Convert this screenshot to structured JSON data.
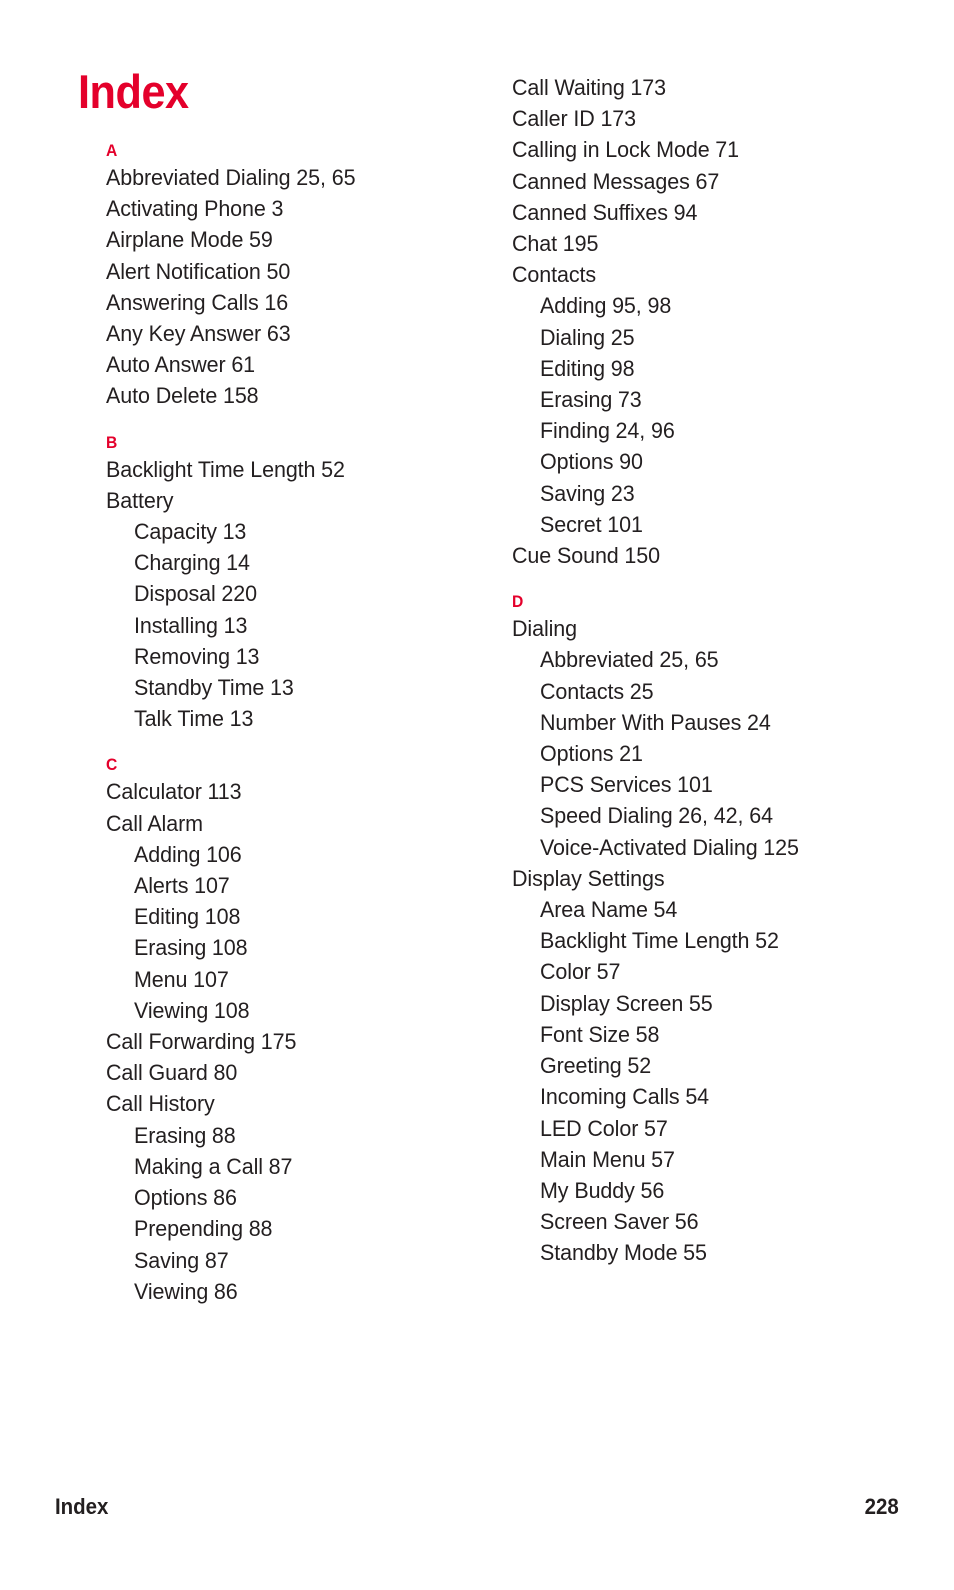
{
  "document": {
    "title": "Index",
    "title_color": "#e4002b",
    "text_color": "#231f20",
    "background_color": "#ffffff"
  },
  "footer": {
    "label": "Index",
    "page_number": "228"
  },
  "columns": [
    {
      "id": "left",
      "sections": [
        {
          "letter": "A",
          "entries": [
            {
              "level": "main",
              "label": "Abbreviated Dialing",
              "pages": "25, 65"
            },
            {
              "level": "main",
              "label": "Activating Phone",
              "pages": "3"
            },
            {
              "level": "main",
              "label": "Airplane Mode",
              "pages": "59"
            },
            {
              "level": "main",
              "label": "Alert Notification",
              "pages": "50"
            },
            {
              "level": "main",
              "label": "Answering Calls",
              "pages": "16"
            },
            {
              "level": "main",
              "label": "Any Key Answer",
              "pages": "63"
            },
            {
              "level": "main",
              "label": "Auto Answer",
              "pages": "61"
            },
            {
              "level": "main",
              "label": "Auto Delete",
              "pages": "158"
            }
          ]
        },
        {
          "letter": "B",
          "entries": [
            {
              "level": "main",
              "label": "Backlight Time Length",
              "pages": "52"
            },
            {
              "level": "main",
              "label": "Battery",
              "pages": ""
            },
            {
              "level": "sub",
              "label": "Capacity",
              "pages": "13"
            },
            {
              "level": "sub",
              "label": "Charging",
              "pages": "14"
            },
            {
              "level": "sub",
              "label": "Disposal",
              "pages": "220"
            },
            {
              "level": "sub",
              "label": "Installing",
              "pages": "13"
            },
            {
              "level": "sub",
              "label": "Removing",
              "pages": "13"
            },
            {
              "level": "sub",
              "label": "Standby Time",
              "pages": "13"
            },
            {
              "level": "sub",
              "label": "Talk Time",
              "pages": "13"
            }
          ]
        },
        {
          "letter": "C",
          "entries": [
            {
              "level": "main",
              "label": "Calculator",
              "pages": "113"
            },
            {
              "level": "main",
              "label": "Call Alarm",
              "pages": ""
            },
            {
              "level": "sub",
              "label": "Adding",
              "pages": "106"
            },
            {
              "level": "sub",
              "label": "Alerts",
              "pages": "107"
            },
            {
              "level": "sub",
              "label": "Editing",
              "pages": "108"
            },
            {
              "level": "sub",
              "label": "Erasing",
              "pages": "108"
            },
            {
              "level": "sub",
              "label": "Menu",
              "pages": "107"
            },
            {
              "level": "sub",
              "label": "Viewing",
              "pages": "108"
            },
            {
              "level": "main",
              "label": "Call Forwarding",
              "pages": "175"
            },
            {
              "level": "main",
              "label": "Call Guard",
              "pages": "80"
            },
            {
              "level": "main",
              "label": "Call History",
              "pages": ""
            },
            {
              "level": "sub",
              "label": "Erasing",
              "pages": "88"
            },
            {
              "level": "sub",
              "label": "Making a Call",
              "pages": "87"
            },
            {
              "level": "sub",
              "label": "Options",
              "pages": "86"
            },
            {
              "level": "sub",
              "label": "Prepending",
              "pages": "88"
            },
            {
              "level": "sub",
              "label": "Saving",
              "pages": "87"
            },
            {
              "level": "sub",
              "label": "Viewing",
              "pages": "86"
            }
          ]
        }
      ]
    },
    {
      "id": "right",
      "sections": [
        {
          "letter": "",
          "continued": true,
          "entries": [
            {
              "level": "main",
              "label": "Call Waiting",
              "pages": "173"
            },
            {
              "level": "main",
              "label": "Caller ID",
              "pages": "173"
            },
            {
              "level": "main",
              "label": "Calling in Lock Mode",
              "pages": "71"
            },
            {
              "level": "main",
              "label": "Canned Messages",
              "pages": "67"
            },
            {
              "level": "main",
              "label": "Canned Suffixes",
              "pages": "94"
            },
            {
              "level": "main",
              "label": "Chat",
              "pages": "195"
            },
            {
              "level": "main",
              "label": "Contacts",
              "pages": ""
            },
            {
              "level": "sub",
              "label": "Adding",
              "pages": "95, 98"
            },
            {
              "level": "sub",
              "label": "Dialing",
              "pages": "25"
            },
            {
              "level": "sub",
              "label": "Editing",
              "pages": "98"
            },
            {
              "level": "sub",
              "label": "Erasing",
              "pages": "73"
            },
            {
              "level": "sub",
              "label": "Finding",
              "pages": "24, 96"
            },
            {
              "level": "sub",
              "label": "Options",
              "pages": "90"
            },
            {
              "level": "sub",
              "label": "Saving",
              "pages": "23"
            },
            {
              "level": "sub",
              "label": "Secret",
              "pages": "101"
            },
            {
              "level": "main",
              "label": "Cue Sound",
              "pages": "150"
            }
          ]
        },
        {
          "letter": "D",
          "entries": [
            {
              "level": "main",
              "label": "Dialing",
              "pages": ""
            },
            {
              "level": "sub",
              "label": "Abbreviated",
              "pages": "25, 65"
            },
            {
              "level": "sub",
              "label": "Contacts",
              "pages": "25"
            },
            {
              "level": "sub",
              "label": "Number With Pauses",
              "pages": "24"
            },
            {
              "level": "sub",
              "label": "Options",
              "pages": "21"
            },
            {
              "level": "sub",
              "label": "PCS Services",
              "pages": "101"
            },
            {
              "level": "sub",
              "label": "Speed Dialing",
              "pages": "26, 42, 64"
            },
            {
              "level": "sub",
              "label": "Voice-Activated Dialing",
              "pages": "125"
            },
            {
              "level": "main",
              "label": "Display Settings",
              "pages": ""
            },
            {
              "level": "sub",
              "label": "Area Name",
              "pages": "54"
            },
            {
              "level": "sub",
              "label": "Backlight Time Length",
              "pages": "52"
            },
            {
              "level": "sub",
              "label": "Color",
              "pages": "57"
            },
            {
              "level": "sub",
              "label": "Display Screen",
              "pages": "55"
            },
            {
              "level": "sub",
              "label": "Font Size",
              "pages": "58"
            },
            {
              "level": "sub",
              "label": "Greeting",
              "pages": "52"
            },
            {
              "level": "sub",
              "label": "Incoming Calls",
              "pages": "54"
            },
            {
              "level": "sub",
              "label": "LED Color",
              "pages": "57"
            },
            {
              "level": "sub",
              "label": "Main Menu",
              "pages": "57"
            },
            {
              "level": "sub",
              "label": "My Buddy",
              "pages": "56"
            },
            {
              "level": "sub",
              "label": "Screen Saver",
              "pages": "56"
            },
            {
              "level": "sub",
              "label": "Standby Mode",
              "pages": "55"
            }
          ]
        }
      ]
    }
  ]
}
